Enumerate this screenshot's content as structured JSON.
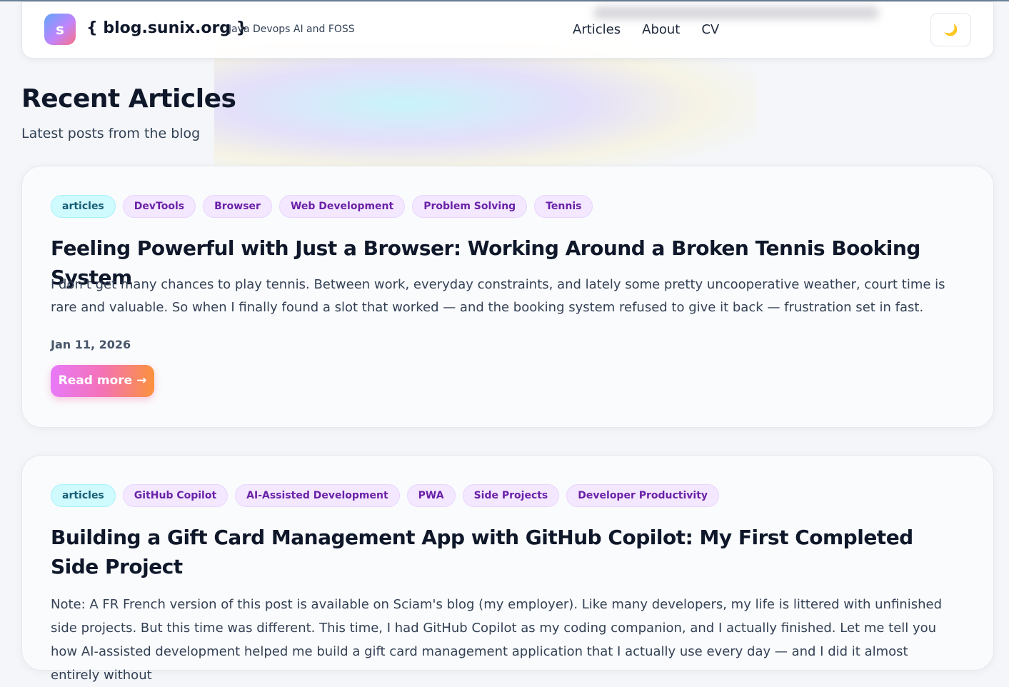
{
  "header": {
    "logo_letter": "s",
    "site_name": "{ blog.sunix.org }",
    "tagline": "Java Devops AI and FOSS",
    "nav": [
      "Articles",
      "About",
      "CV"
    ],
    "theme_toggle_icon": "moon-icon",
    "theme_toggle_glyph": "🌙"
  },
  "page": {
    "title": "Recent Articles",
    "subtitle": "Latest posts from the blog"
  },
  "articles": [
    {
      "tags": [
        "articles",
        "DevTools",
        "Browser",
        "Web Development",
        "Problem Solving",
        "Tennis"
      ],
      "title": "Feeling Powerful with Just a Browser: Working Around a Broken Tennis Booking System",
      "excerpt": "I don't get many chances to play tennis. Between work, everyday constraints, and lately some pretty uncooperative weather, court time is rare and valuable. So when I finally found a slot that worked — and the booking system refused to give it back — frustration set in fast.",
      "date": "Jan 11, 2026",
      "read_more": "Read more →"
    },
    {
      "tags": [
        "articles",
        "GitHub Copilot",
        "AI-Assisted Development",
        "PWA",
        "Side Projects",
        "Developer Productivity"
      ],
      "title": "Building a Gift Card Management App with GitHub Copilot: My First Completed Side Project",
      "excerpt": "Note: A FR French version of this post is available on Sciam's blog (my employer). Like many developers, my life is littered with unfinished side projects. But this time was different. This time, I had GitHub Copilot as my coding companion, and I actually finished. Let me tell you how AI-assisted development helped me build a gift card management application that I actually use every day — and I did it almost entirely without"
    }
  ]
}
